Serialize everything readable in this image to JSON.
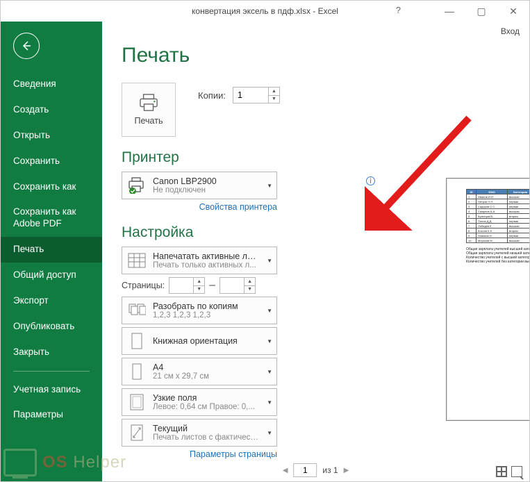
{
  "titlebar": {
    "title": "конвертация эксель в пдф.xlsx - Excel",
    "help": "?",
    "login": "Вход"
  },
  "sidebar": {
    "items": [
      "Сведения",
      "Создать",
      "Открыть",
      "Сохранить",
      "Сохранить как",
      "Сохранить как Adobe PDF",
      "Печать",
      "Общий доступ",
      "Экспорт",
      "Опубликовать",
      "Закрыть"
    ],
    "bottom": [
      "Учетная запись",
      "Параметры"
    ],
    "active_index": 6
  },
  "page": {
    "title": "Печать",
    "print_button": "Печать",
    "copies_label": "Копии:",
    "copies_value": "1"
  },
  "printer": {
    "heading": "Принтер",
    "name": "Canon LBP2900",
    "status": "Не подключен",
    "properties_link": "Свойства принтера"
  },
  "settings": {
    "heading": "Настройка",
    "sheets": {
      "line1": "Напечатать активные листы",
      "line2": "Печать только активных л..."
    },
    "pages_label": "Страницы:",
    "pages_from": "",
    "pages_to": "",
    "collate": {
      "line1": "Разобрать по копиям",
      "line2": "1,2,3   1,2,3   1,2,3"
    },
    "orientation": {
      "line1": "Книжная ориентация",
      "line2": ""
    },
    "paper": {
      "line1": "A4",
      "line2": "21 см x 29,7 см"
    },
    "margins": {
      "line1": "Узкие поля",
      "line2": "Левое:  0,64 см  Правое:  0,..."
    },
    "scale": {
      "line1": "Текущий",
      "line2": "Печать листов с фактическ..."
    },
    "page_params_link": "Параметры страницы"
  },
  "pager": {
    "current": "1",
    "of_label": "из 1"
  },
  "watermark": {
    "brand1": "OS",
    "brand2": " Helper"
  }
}
